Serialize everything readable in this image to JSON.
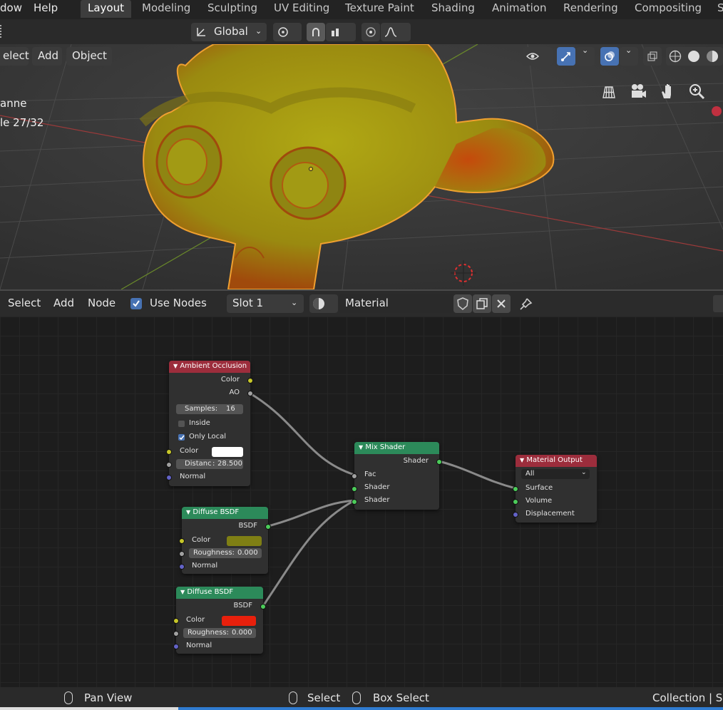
{
  "top_menu": {
    "window": "dow",
    "help": "Help"
  },
  "workspace_tabs": [
    "Layout",
    "Modeling",
    "Sculpting",
    "UV Editing",
    "Texture Paint",
    "Shading",
    "Animation",
    "Rendering",
    "Compositing",
    "S"
  ],
  "viewport_header": {
    "transform_orientation": "Global",
    "menu_select": "elect",
    "menu_add": "Add",
    "menu_object": "Object"
  },
  "viewport_overlay": {
    "object_name": "anne",
    "frame_info": "le 27/32"
  },
  "node_header": {
    "menu_select": "Select",
    "menu_add": "Add",
    "menu_node": "Node",
    "use_nodes_label": "Use Nodes",
    "use_nodes_checked": true,
    "slot": "Slot 1",
    "material_name": "Material"
  },
  "nodes": {
    "ambient_occlusion": {
      "title": "Ambient Occlusion",
      "out_color": "Color",
      "out_ao": "AO",
      "samples_label": "Samples:",
      "samples_value": "16",
      "inside_label": "Inside",
      "only_local_label": "Only Local",
      "color_label": "Color",
      "distance_label": "Distanc",
      "distance_value": "28.500",
      "normal_label": "Normal"
    },
    "diffuse1": {
      "title": "Diffuse BSDF",
      "out_bsdf": "BSDF",
      "color_label": "Color",
      "color_value": "#7f7f14",
      "roughness_label": "Roughness:",
      "roughness_value": "0.000",
      "normal_label": "Normal"
    },
    "diffuse2": {
      "title": "Diffuse BSDF",
      "out_bsdf": "BSDF",
      "color_label": "Color",
      "color_value": "#e8200c",
      "roughness_label": "Roughness:",
      "roughness_value": "0.000",
      "normal_label": "Normal"
    },
    "mix_shader": {
      "title": "Mix Shader",
      "out_shader": "Shader",
      "in_fac": "Fac",
      "in_shader1": "Shader",
      "in_shader2": "Shader"
    },
    "material_output": {
      "title": "Material Output",
      "target": "All",
      "in_surface": "Surface",
      "in_volume": "Volume",
      "in_displacement": "Displacement"
    }
  },
  "status_bar": {
    "pan_view": "Pan View",
    "select": "Select",
    "box_select": "Box Select",
    "collection": "Collection | Su"
  },
  "colors": {
    "accent": "#4772b3",
    "node_header_red": "#9c2d3c",
    "node_header_green": "#2c8a5a",
    "selection_outline": "#f0a030"
  }
}
